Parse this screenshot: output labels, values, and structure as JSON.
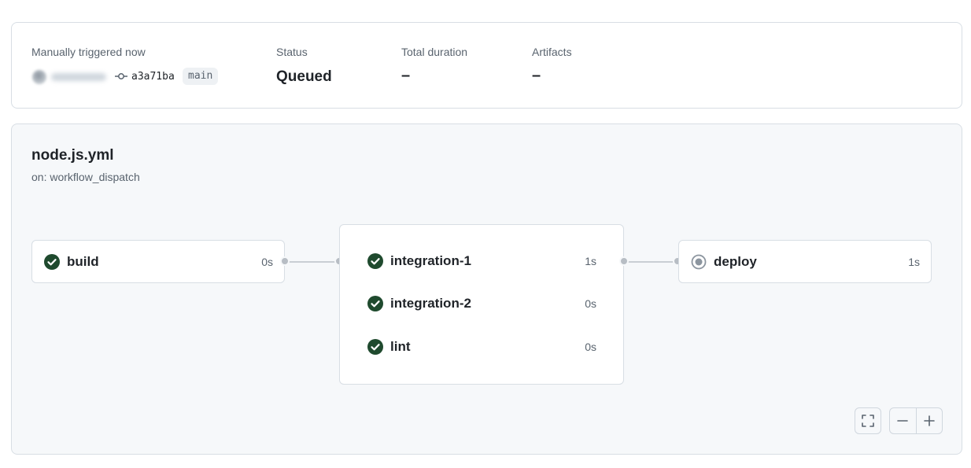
{
  "summary": {
    "trigger_label": "Manually triggered now",
    "commit_sha": "a3a71ba",
    "branch": "main",
    "status_label": "Status",
    "status_value": "Queued",
    "duration_label": "Total duration",
    "duration_value": "–",
    "artifacts_label": "Artifacts",
    "artifacts_value": "–"
  },
  "workflow": {
    "name": "node.js.yml",
    "trigger": "on: workflow_dispatch"
  },
  "jobs": {
    "build": {
      "name": "build",
      "duration": "0s",
      "status": "success"
    },
    "group": [
      {
        "name": "integration-1",
        "duration": "1s",
        "status": "success"
      },
      {
        "name": "integration-2",
        "duration": "0s",
        "status": "success"
      },
      {
        "name": "lint",
        "duration": "0s",
        "status": "success"
      }
    ],
    "deploy": {
      "name": "deploy",
      "duration": "1s",
      "status": "queued"
    }
  },
  "colors": {
    "success": "#1f4a2e",
    "queued": "#8c959f",
    "connector": "#c9ced4"
  },
  "controls": {
    "fullscreen_icon": "fullscreen-icon",
    "zoom_out_icon": "minus-icon",
    "zoom_in_icon": "plus-icon"
  }
}
